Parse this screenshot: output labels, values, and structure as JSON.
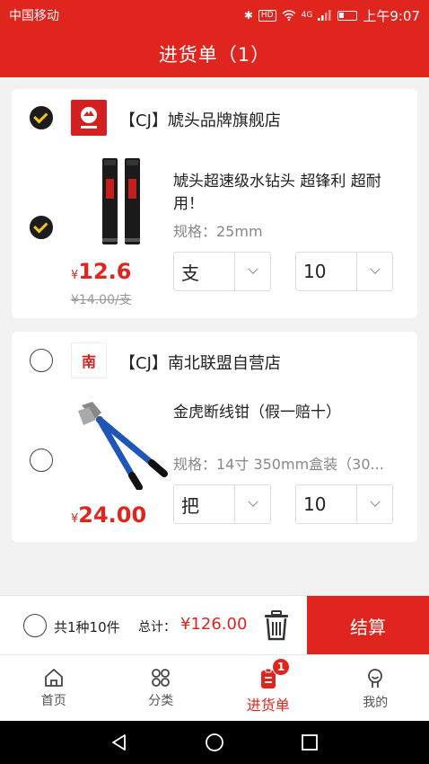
{
  "status": {
    "carrier": "中国移动",
    "hd": "HD",
    "net": "4G",
    "time": "上午9:07"
  },
  "header": {
    "title": "进货单（1）"
  },
  "shops": [
    {
      "name": "【CJ】虓头品牌旗舰店",
      "logo_text": "虓头品牌",
      "checked": true,
      "items": [
        {
          "title": "虓头超速级水钻头 超锋利 超耐用！",
          "spec": "规格：25mm",
          "price_symbol": "¥",
          "price": "12.6",
          "original_price": "¥14.00/支",
          "unit": "支",
          "qty": "10",
          "checked": true
        }
      ]
    },
    {
      "name": "【CJ】南北联盟自营店",
      "logo_text": "南",
      "checked": false,
      "items": [
        {
          "title": "金虎断线钳（假一赔十）",
          "spec": "规格：14寸 350mm盒装（30...",
          "price_symbol": "¥",
          "price": "24.00",
          "unit": "把",
          "qty": "10",
          "checked": false
        }
      ]
    }
  ],
  "checkout": {
    "count_text": "共1种10件",
    "total_label": "总计：",
    "total_value": "¥126.00",
    "pay_label": "结算"
  },
  "tabs": [
    {
      "label": "首页",
      "icon": "home-icon"
    },
    {
      "label": "分类",
      "icon": "category-icon"
    },
    {
      "label": "进货单",
      "icon": "order-list-icon",
      "badge": "1",
      "active": true
    },
    {
      "label": "我的",
      "icon": "profile-icon"
    }
  ],
  "colors": {
    "brand": "#e0251f",
    "check_mark": "#f5c518"
  }
}
